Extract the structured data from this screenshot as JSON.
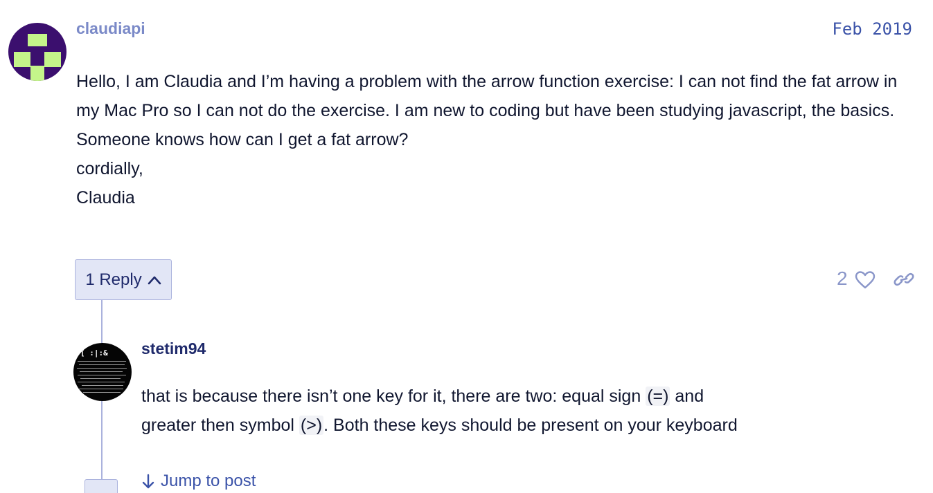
{
  "post": {
    "username": "claudiapi",
    "date": "Feb 2019",
    "body_lines": [
      "Hello, I am Claudia and I’m having a problem with the arrow function exercise: I can not find the fat arrow in my Mac Pro so I can not do the exercise. I am new to coding but have been studying javascript, the basics. Someone knows how can I get a fat arrow?",
      "cordially,",
      "Claudia"
    ],
    "reply_button_label": "1 Reply",
    "like_count": "2",
    "icons": {
      "reply_toggle": "chevron-up-icon",
      "like": "heart-icon",
      "share": "link-icon"
    }
  },
  "reply": {
    "username": "stetim94",
    "body_part1": "that is because there isn’t one key for it, there are two: equal sign ",
    "code1": "(=)",
    "body_part2": " and",
    "body_part3": "greater then symbol ",
    "code2": "(>)",
    "body_part4": ". Both these keys should be present on your keyboard",
    "jump_label": "Jump to post",
    "avatar_text": "[ :|:&"
  },
  "colors": {
    "accent": "#3a52a8",
    "username_muted": "#7b8ac8",
    "avatar1_bg": "#3b0f6e",
    "avatar1_fg": "#c4f58a",
    "button_bg": "#e2e6f6"
  }
}
